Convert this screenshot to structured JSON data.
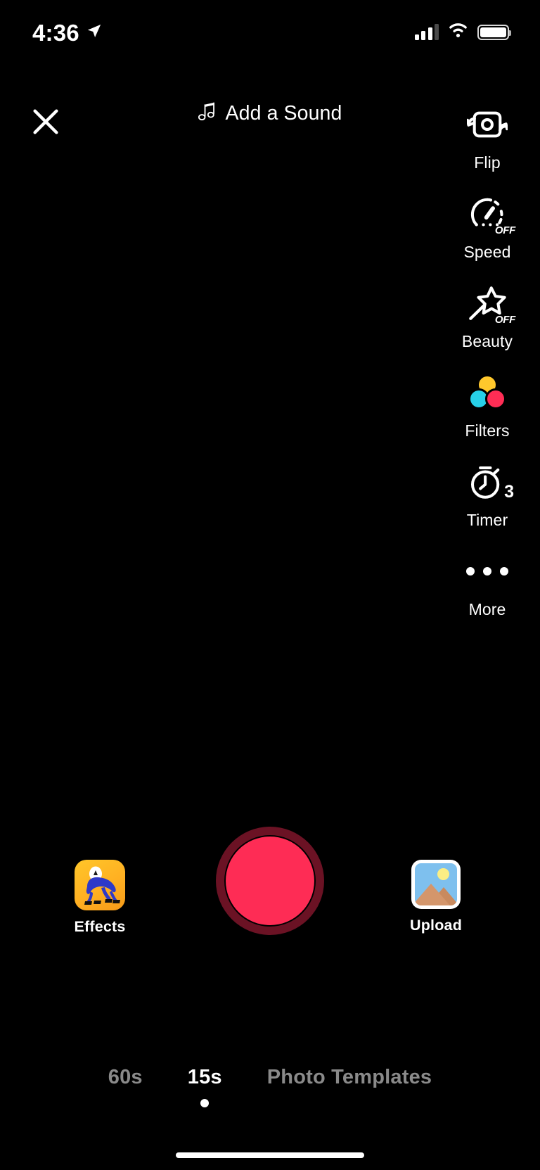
{
  "status_bar": {
    "time": "4:36",
    "location_icon": "location-arrow-icon",
    "cellular_icon": "cellular-signal-icon",
    "wifi_icon": "wifi-icon",
    "battery_icon": "battery-full-icon"
  },
  "top_bar": {
    "close_icon": "close-x-icon",
    "sound_icon": "music-note-icon",
    "sound_label": "Add a Sound"
  },
  "tools": [
    {
      "label": "Flip",
      "icon": "camera-flip-icon",
      "badge": ""
    },
    {
      "label": "Speed",
      "icon": "speedometer-icon",
      "badge": "OFF"
    },
    {
      "label": "Beauty",
      "icon": "magic-wand-icon",
      "badge": "OFF"
    },
    {
      "label": "Filters",
      "icon": "color-circles-icon",
      "badge": ""
    },
    {
      "label": "Timer",
      "icon": "stopwatch-icon",
      "badge": "3"
    },
    {
      "label": "More",
      "icon": "ellipsis-icon",
      "badge": ""
    }
  ],
  "bottom_controls": {
    "effects_label": "Effects",
    "effects_icon": "effects-creature-icon",
    "record_icon": "record-button-icon",
    "upload_label": "Upload",
    "upload_icon": "photo-library-icon"
  },
  "mode_selector": {
    "modes": [
      {
        "label": "60s",
        "active": false
      },
      {
        "label": "15s",
        "active": true
      },
      {
        "label": "Photo Templates",
        "active": false
      }
    ]
  },
  "colors": {
    "record_red": "#FE2C55",
    "record_ring": "#6e1327",
    "effects_orange": "#FFB022",
    "filter_yellow": "#FFC82C",
    "filter_cyan": "#27D0E8",
    "filter_pink": "#FF2D55",
    "inactive_gray": "#8a8a8a",
    "background": "#000000"
  }
}
